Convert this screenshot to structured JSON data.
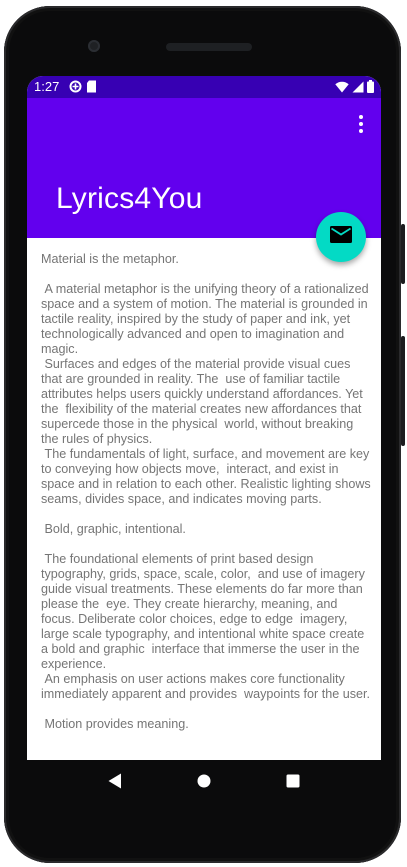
{
  "status_bar": {
    "time": "1:27",
    "left_icons": [
      "data-saver-icon",
      "sd-card-icon"
    ],
    "right_icons": [
      "wifi-icon",
      "cellular-signal-icon",
      "battery-icon"
    ]
  },
  "app_bar": {
    "title": "Lyrics4You",
    "menu_icon": "more-vert-icon",
    "color": "#6200ee",
    "status_color": "#3700b3"
  },
  "fab": {
    "icon": "email-icon",
    "color": "#03dac5"
  },
  "content": {
    "text": "Material is the metaphor.\n\n A material metaphor is the unifying theory of a rationalized space and a system of motion. The material is grounded in tactile reality, inspired by the study of paper and ink, yet  technologically advanced and open to imagination and magic.\n Surfaces and edges of the material provide visual cues that are grounded in reality. The  use of familiar tactile attributes helps users quickly understand affordances. Yet the  flexibility of the material creates new affordances that supercede those in the physical  world, without breaking the rules of physics.\n The fundamentals of light, surface, and movement are key to conveying how objects move,  interact, and exist in space and in relation to each other. Realistic lighting shows  seams, divides space, and indicates moving parts.\n\n Bold, graphic, intentional.\n\n The foundational elements of print based design typography, grids, space, scale, color,  and use of imagery guide visual treatments. These elements do far more than please the  eye. They create hierarchy, meaning, and focus. Deliberate color choices, edge to edge  imagery, large scale typography, and intentional white space create a bold and graphic  interface that immerse the user in the experience.\n An emphasis on user actions makes core functionality immediately apparent and provides  waypoints for the user.\n\n Motion provides meaning."
  },
  "nav_bar": {
    "buttons": [
      "back-icon",
      "home-icon",
      "recents-icon"
    ]
  }
}
